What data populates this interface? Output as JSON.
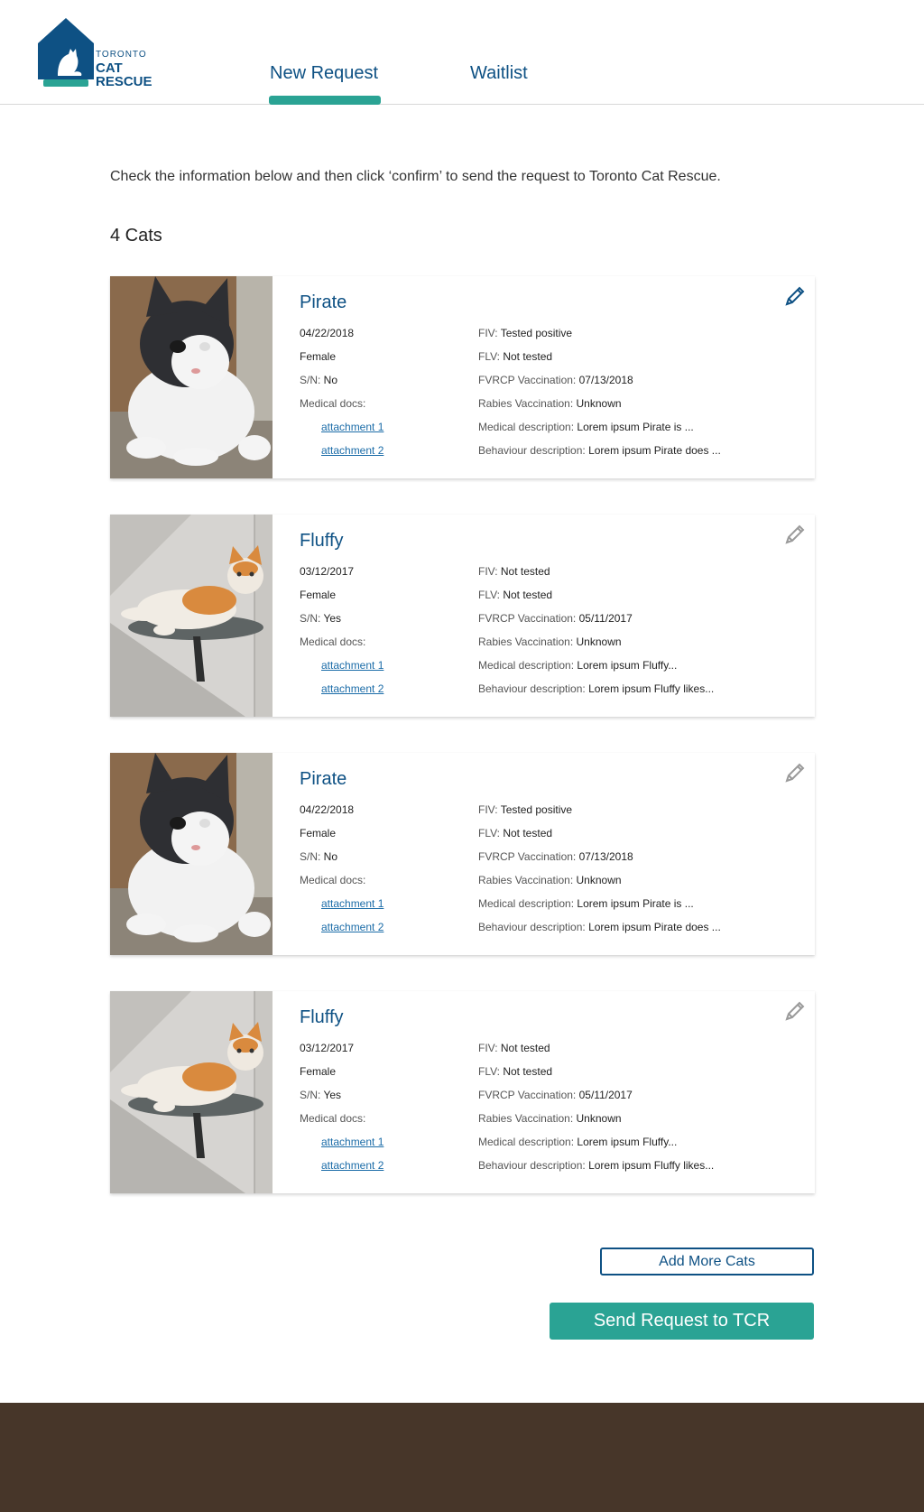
{
  "header": {
    "logo": {
      "line1": "TORONTO",
      "line2": "CAT",
      "line3": "RESCUE"
    },
    "tabs": [
      {
        "label": "New Request",
        "active": true
      },
      {
        "label": "Waitlist",
        "active": false
      }
    ]
  },
  "intro_text": "Check the information below and then click ‘confirm’ to send the request to Toronto Cat Rescue.",
  "cat_count": "4 Cats",
  "labels": {
    "sn": "S/N:",
    "medical_docs": "Medical docs:",
    "fiv": "FIV:",
    "flv": "FLV:",
    "fvrcp": "FVRCP Vaccination:",
    "rabies": "Rabies Vaccination:",
    "medical_desc": "Medical description:",
    "behaviour_desc": "Behaviour description:"
  },
  "cats": [
    {
      "name": "Pirate",
      "dob": "04/22/2018",
      "sex": "Female",
      "sn": "No",
      "attachments": [
        "attachment 1",
        "attachment 2"
      ],
      "fiv": "Tested positive",
      "flv": "Not tested",
      "fvrcp": "07/13/2018",
      "rabies": "Unknown",
      "medical_desc": "Lorem ipsum Pirate is ...",
      "behaviour_desc": "Lorem ipsum Pirate does ..."
    },
    {
      "name": "Fluffy",
      "dob": "03/12/2017",
      "sex": "Female",
      "sn": "Yes",
      "attachments": [
        "attachment 1",
        "attachment 2"
      ],
      "fiv": "Not tested",
      "flv": "Not tested",
      "fvrcp": "05/11/2017",
      "rabies": "Unknown",
      "medical_desc": "Lorem ipsum Fluffy...",
      "behaviour_desc": "Lorem ipsum Fluffy likes..."
    },
    {
      "name": "Pirate",
      "dob": "04/22/2018",
      "sex": "Female",
      "sn": "No",
      "attachments": [
        "attachment 1",
        "attachment 2"
      ],
      "fiv": "Tested positive",
      "flv": "Not tested",
      "fvrcp": "07/13/2018",
      "rabies": "Unknown",
      "medical_desc": "Lorem ipsum Pirate is ...",
      "behaviour_desc": "Lorem ipsum Pirate does ..."
    },
    {
      "name": "Fluffy",
      "dob": "03/12/2017",
      "sex": "Female",
      "sn": "Yes",
      "attachments": [
        "attachment 1",
        "attachment 2"
      ],
      "fiv": "Not tested",
      "flv": "Not tested",
      "fvrcp": "05/11/2017",
      "rabies": "Unknown",
      "medical_desc": "Lorem ipsum Fluffy...",
      "behaviour_desc": "Lorem ipsum Fluffy likes..."
    }
  ],
  "buttons": {
    "add_more": "Add More Cats",
    "send": "Send Request to TCR"
  },
  "colors": {
    "brand_blue": "#0e5184",
    "accent_teal": "#2aa394",
    "footer_brown": "#473629"
  }
}
